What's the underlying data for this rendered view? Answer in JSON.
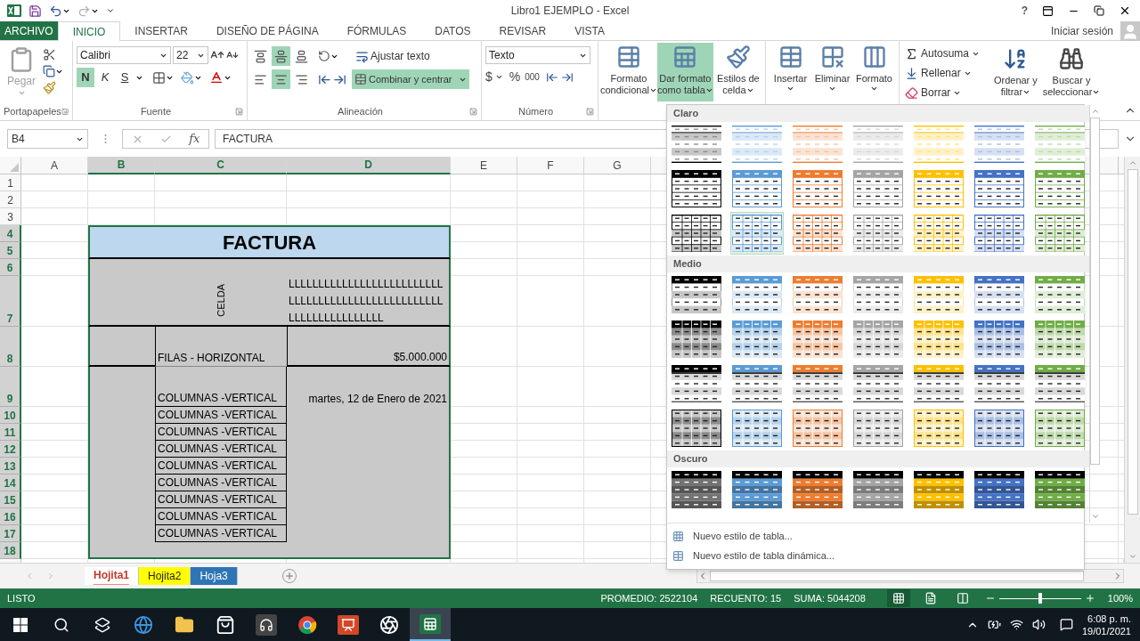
{
  "window": {
    "title": "Libro1 EJEMPLO - Excel",
    "help": "?"
  },
  "ribbon_tabs": [
    {
      "label": "ARCHIVO",
      "kind": "file",
      "selected": false
    },
    {
      "label": "INICIO",
      "kind": "tab",
      "selected": true
    },
    {
      "label": "INSERTAR",
      "kind": "tab",
      "selected": false
    },
    {
      "label": "DISEÑO DE PÁGINA",
      "kind": "tab",
      "selected": false
    },
    {
      "label": "FÓRMULAS",
      "kind": "tab",
      "selected": false
    },
    {
      "label": "DATOS",
      "kind": "tab",
      "selected": false
    },
    {
      "label": "REVISAR",
      "kind": "tab",
      "selected": false
    },
    {
      "label": "VISTA",
      "kind": "tab",
      "selected": false
    }
  ],
  "account": {
    "label": "Iniciar sesión"
  },
  "clipboard": {
    "paste": {
      "label": "Pegar",
      "disabled": true
    },
    "group": "Portapapeles"
  },
  "font": {
    "name": "Calibri",
    "size": "22",
    "group": "Fuente",
    "styles": [
      {
        "label": "N",
        "selected": true
      },
      {
        "label": "K",
        "selected": false
      },
      {
        "label": "S",
        "selected": false
      }
    ]
  },
  "alignment": {
    "group": "Alineación",
    "vertical": [
      {
        "kind": "top",
        "selected": false
      },
      {
        "kind": "middle",
        "selected": true
      },
      {
        "kind": "bottom",
        "selected": false
      }
    ],
    "horizontal": [
      {
        "kind": "left",
        "selected": false
      },
      {
        "kind": "center",
        "selected": true
      },
      {
        "kind": "right",
        "selected": false
      }
    ],
    "wrap": {
      "label": "Ajustar texto",
      "selected": false
    },
    "merge": {
      "label": "Combinar y centrar",
      "selected": true
    }
  },
  "number": {
    "group": "Número",
    "format": "Texto",
    "currency": "$",
    "percent": "%",
    "thousands": "000"
  },
  "styles": [
    {
      "lines": [
        "Formato",
        "condicional"
      ],
      "kind": "conditional",
      "selected": false
    },
    {
      "lines": [
        "Dar formato",
        "como tabla"
      ],
      "kind": "table",
      "selected": true
    },
    {
      "lines": [
        "Estilos de",
        "celda"
      ],
      "kind": "cell",
      "selected": false
    }
  ],
  "cells": [
    {
      "label": "Insertar",
      "kind": "insert"
    },
    {
      "label": "Eliminar",
      "kind": "delete"
    },
    {
      "label": "Formato",
      "kind": "format"
    }
  ],
  "editing": {
    "small": [
      {
        "label": "Autosuma",
        "kind": "sum"
      },
      {
        "label": "Rellenar",
        "kind": "fill"
      },
      {
        "label": "Borrar",
        "kind": "clear"
      }
    ],
    "large": [
      {
        "lines": [
          "Ordenar y",
          "filtrar"
        ],
        "kind": "sort"
      },
      {
        "lines": [
          "Buscar y",
          "seleccionar"
        ],
        "kind": "find"
      }
    ]
  },
  "formula_bar": {
    "name_box": "B4",
    "function_label": "fx",
    "value": "FACTURA"
  },
  "sheet": {
    "columns": [
      {
        "label": "A",
        "selected": false
      },
      {
        "label": "B",
        "selected": true
      },
      {
        "label": "C",
        "selected": true
      },
      {
        "label": "D",
        "selected": true
      },
      {
        "label": "E",
        "selected": false
      },
      {
        "label": "F",
        "selected": false
      },
      {
        "label": "G",
        "selected": false
      }
    ],
    "rows": [
      {
        "number": "1",
        "selected": false
      },
      {
        "number": "2",
        "selected": false
      },
      {
        "number": "3",
        "selected": false
      },
      {
        "number": "4",
        "selected": true
      },
      {
        "number": "5",
        "selected": true
      },
      {
        "number": "6",
        "selected": true
      },
      {
        "number": "7",
        "selected": true
      },
      {
        "number": "8",
        "selected": true
      },
      {
        "number": "9",
        "selected": true
      },
      {
        "number": "10",
        "selected": true
      },
      {
        "number": "11",
        "selected": true
      },
      {
        "number": "12",
        "selected": true
      },
      {
        "number": "13",
        "selected": true
      },
      {
        "number": "14",
        "selected": true
      },
      {
        "number": "15",
        "selected": true
      },
      {
        "number": "16",
        "selected": true
      },
      {
        "number": "17",
        "selected": true
      },
      {
        "number": "18",
        "selected": true
      }
    ],
    "table": {
      "title": "FACTURA",
      "cell_c7": "CELDA",
      "cell_d7": "LLLLLLLLLLLLLLLLLLLLLLLLLLLLLLLLLLLLLLLLLLLLLLLLLLLLLLLLLLLLLLLLLLLL",
      "cell_c8": "FILAS - HORIZONTAL",
      "cell_d8": "$5.000.000",
      "cell_c9": "COLUMNAS -VERTICAL",
      "cell_d9": "martes, 12 de Enero de 2021",
      "column_c": [
        "COLUMNAS -VERTICAL",
        "COLUMNAS -VERTICAL",
        "COLUMNAS -VERTICAL",
        "COLUMNAS -VERTICAL",
        "COLUMNAS -VERTICAL",
        "COLUMNAS -VERTICAL",
        "COLUMNAS -VERTICAL",
        "COLUMNAS -VERTICAL"
      ]
    }
  },
  "gallery": {
    "sections": [
      {
        "title": "Claro",
        "rows": [
          {
            "kind": "banded",
            "swatches": [
              {
                "color": "#000000",
                "hovered": false
              },
              {
                "color": "#5b9bd5",
                "hovered": false
              },
              {
                "color": "#ed7d31",
                "hovered": false
              },
              {
                "color": "#a5a5a5",
                "hovered": false
              },
              {
                "color": "#ffc000",
                "hovered": false
              },
              {
                "color": "#4472c4",
                "hovered": false
              },
              {
                "color": "#70ad47",
                "hovered": false
              }
            ]
          },
          {
            "kind": "outline",
            "swatches": [
              {
                "color": "#000000",
                "hovered": false
              },
              {
                "color": "#5b9bd5",
                "hovered": false
              },
              {
                "color": "#ed7d31",
                "hovered": false
              },
              {
                "color": "#a5a5a5",
                "hovered": false
              },
              {
                "color": "#ffc000",
                "hovered": false
              },
              {
                "color": "#4472c4",
                "hovered": false
              },
              {
                "color": "#70ad47",
                "hovered": false
              }
            ]
          },
          {
            "kind": "grid",
            "swatches": [
              {
                "color": "#000000",
                "hovered": false
              },
              {
                "color": "#5b9bd5",
                "hovered": true
              },
              {
                "color": "#ed7d31",
                "hovered": false
              },
              {
                "color": "#a5a5a5",
                "hovered": false
              },
              {
                "color": "#ffc000",
                "hovered": false
              },
              {
                "color": "#4472c4",
                "hovered": false
              },
              {
                "color": "#70ad47",
                "hovered": false
              }
            ]
          }
        ]
      },
      {
        "title": "Medio",
        "rows": [
          {
            "kind": "header-banded",
            "swatches": [
              {
                "color": "#000000",
                "hovered": false
              },
              {
                "color": "#5b9bd5",
                "hovered": false
              },
              {
                "color": "#ed7d31",
                "hovered": false
              },
              {
                "color": "#a5a5a5",
                "hovered": false
              },
              {
                "color": "#ffc000",
                "hovered": false
              },
              {
                "color": "#4472c4",
                "hovered": false
              },
              {
                "color": "#70ad47",
                "hovered": false
              }
            ]
          },
          {
            "kind": "header-grid",
            "swatches": [
              {
                "color": "#000000",
                "hovered": false
              },
              {
                "color": "#5b9bd5",
                "hovered": false
              },
              {
                "color": "#ed7d31",
                "hovered": false
              },
              {
                "color": "#a5a5a5",
                "hovered": false
              },
              {
                "color": "#ffc000",
                "hovered": false
              },
              {
                "color": "#4472c4",
                "hovered": false
              },
              {
                "color": "#70ad47",
                "hovered": false
              }
            ]
          },
          {
            "kind": "header-underline",
            "swatches": [
              {
                "color": "#000000",
                "hovered": false
              },
              {
                "color": "#5b9bd5",
                "hovered": false
              },
              {
                "color": "#ed7d31",
                "hovered": false
              },
              {
                "color": "#a5a5a5",
                "hovered": false
              },
              {
                "color": "#ffc000",
                "hovered": false
              },
              {
                "color": "#4472c4",
                "hovered": false
              },
              {
                "color": "#70ad47",
                "hovered": false
              }
            ]
          },
          {
            "kind": "grid-filled",
            "swatches": [
              {
                "color": "#000000",
                "hovered": false
              },
              {
                "color": "#5b9bd5",
                "hovered": false
              },
              {
                "color": "#ed7d31",
                "hovered": false
              },
              {
                "color": "#a5a5a5",
                "hovered": false
              },
              {
                "color": "#ffc000",
                "hovered": false
              },
              {
                "color": "#4472c4",
                "hovered": false
              },
              {
                "color": "#70ad47",
                "hovered": false
              }
            ]
          }
        ]
      },
      {
        "title": "Oscuro",
        "rows": [
          {
            "kind": "dark",
            "swatches": [
              {
                "color": "#737373",
                "hovered": false
              },
              {
                "color": "#5b9bd5",
                "hovered": false
              },
              {
                "color": "#ed7d31",
                "hovered": false
              },
              {
                "color": "#a5a5a5",
                "hovered": false
              },
              {
                "color": "#ffc000",
                "hovered": false
              },
              {
                "color": "#4472c4",
                "hovered": false
              },
              {
                "color": "#70ad47",
                "hovered": false
              }
            ]
          }
        ]
      }
    ],
    "actions": [
      {
        "label": "Nuevo estilo de tabla...",
        "kind": "table"
      },
      {
        "label": "Nuevo estilo de tabla dinámica...",
        "kind": "pivot"
      }
    ]
  },
  "sheet_tabs": [
    {
      "label": "Hojita1",
      "color": "#ff8080",
      "selected": true
    },
    {
      "label": "Hojita2",
      "color": "#ffff00",
      "selected": false
    },
    {
      "label": "Hoja3",
      "color": "#2e75b6",
      "selected": false
    }
  ],
  "status_bar": {
    "mode": "LISTO",
    "stats": [
      "PROMEDIO: 2522104",
      "RECUENTO: 15",
      "SUMA: 5044208"
    ],
    "views": [
      {
        "kind": "normal",
        "selected": true
      },
      {
        "kind": "layout",
        "selected": false
      },
      {
        "kind": "break",
        "selected": false
      }
    ],
    "zoom": {
      "level": 0.5,
      "label": "100%"
    }
  },
  "taskbar": {
    "apps": [
      {
        "kind": "start",
        "active": false
      },
      {
        "kind": "search",
        "active": false
      },
      {
        "kind": "taskview",
        "active": false
      },
      {
        "kind": "edge",
        "active": false
      },
      {
        "kind": "explorer",
        "active": false
      },
      {
        "kind": "store",
        "active": false
      },
      {
        "kind": "headset",
        "active": false
      },
      {
        "kind": "chrome",
        "active": false
      },
      {
        "kind": "powerpoint",
        "active": false
      },
      {
        "kind": "obs",
        "active": false
      },
      {
        "kind": "excel",
        "active": true
      }
    ],
    "time": "6:08 p. m.",
    "date": "19/01/2021"
  }
}
